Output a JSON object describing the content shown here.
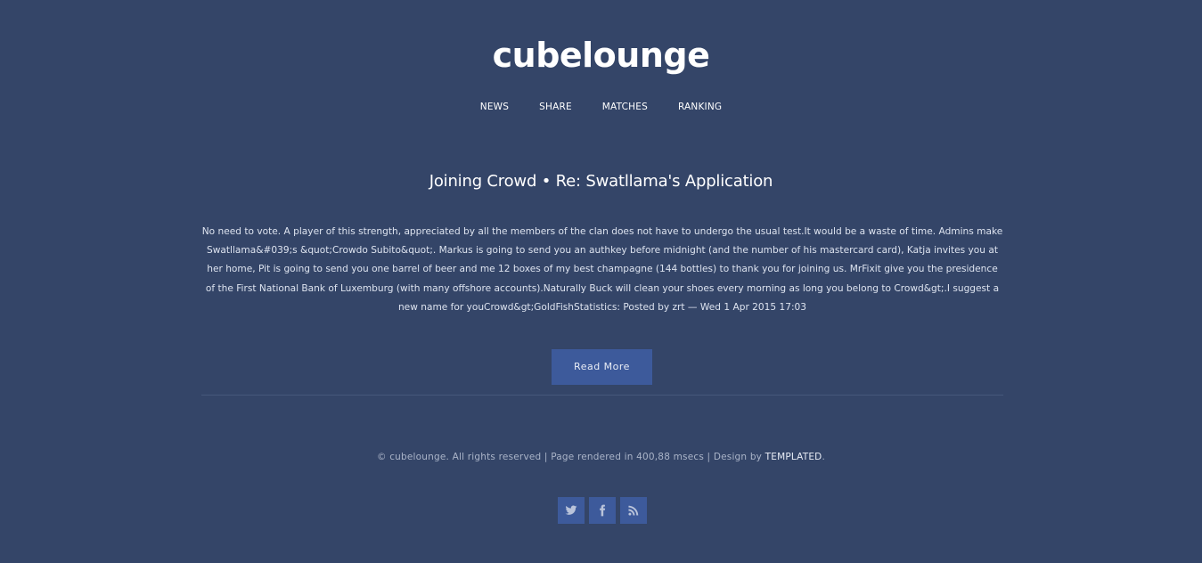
{
  "site": {
    "logo": "cubelounge"
  },
  "nav": {
    "items": [
      {
        "label": "NEWS"
      },
      {
        "label": "SHARE"
      },
      {
        "label": "MATCHES"
      },
      {
        "label": "RANKING"
      }
    ]
  },
  "post": {
    "title": "Joining Crowd • Re: Swatllama's Application",
    "body": "No need to vote. A player of this strength, appreciated by all the members of the clan does not have to undergo the usual test.It would be a waste of time. Admins make Swatllama&#039;s &quot;Crowdo Subito&quot;. Markus is going to send you an authkey before midnight (and the number of his mastercard card), Katja invites you at her home, Pit is going to send you one barrel of beer and me 12 boxes of my best champagne (144 bottles) to thank you for joining us. MrFixit give you the presidence of the First National Bank of Luxemburg (with many offshore accounts).Naturally Buck will clean your shoes every morning as long you belong to Crowd&gt;.I suggest a new name for youCrowd&gt;GoldFishStatistics: Posted by zrt — Wed 1 Apr 2015 17:03",
    "read_more_label": "Read More"
  },
  "footer": {
    "text": "© cubelounge. All rights reserved | Page rendered in 400,88 msecs | Design by ",
    "designer_link": "TEMPLATED",
    "text_end": ".",
    "social": [
      {
        "icon": "twitter-icon"
      },
      {
        "icon": "facebook-icon"
      },
      {
        "icon": "rss-icon"
      }
    ]
  },
  "colors": {
    "background": "#344568",
    "accent": "#3d5a9b",
    "text": "#ffffff"
  }
}
